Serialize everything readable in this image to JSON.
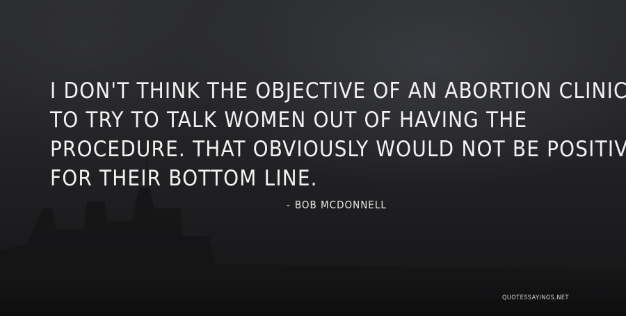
{
  "quote": {
    "lines": [
      "I DON'T THINK THE OBJECTIVE OF AN ABORTION CLINIC IS",
      "TO TRY TO TALK WOMEN OUT OF HAVING THE",
      "PROCEDURE. THAT OBVIOUSLY WOULD NOT BE POSITIVE",
      "FOR THEIR BOTTOM LINE."
    ]
  },
  "author": {
    "dash": "-",
    "name": "BOB MCDONNELL"
  },
  "watermark": "QUOTESSAYINGS.NET",
  "colors": {
    "text": "#f2f2f2",
    "background": "#1c1c1e"
  }
}
